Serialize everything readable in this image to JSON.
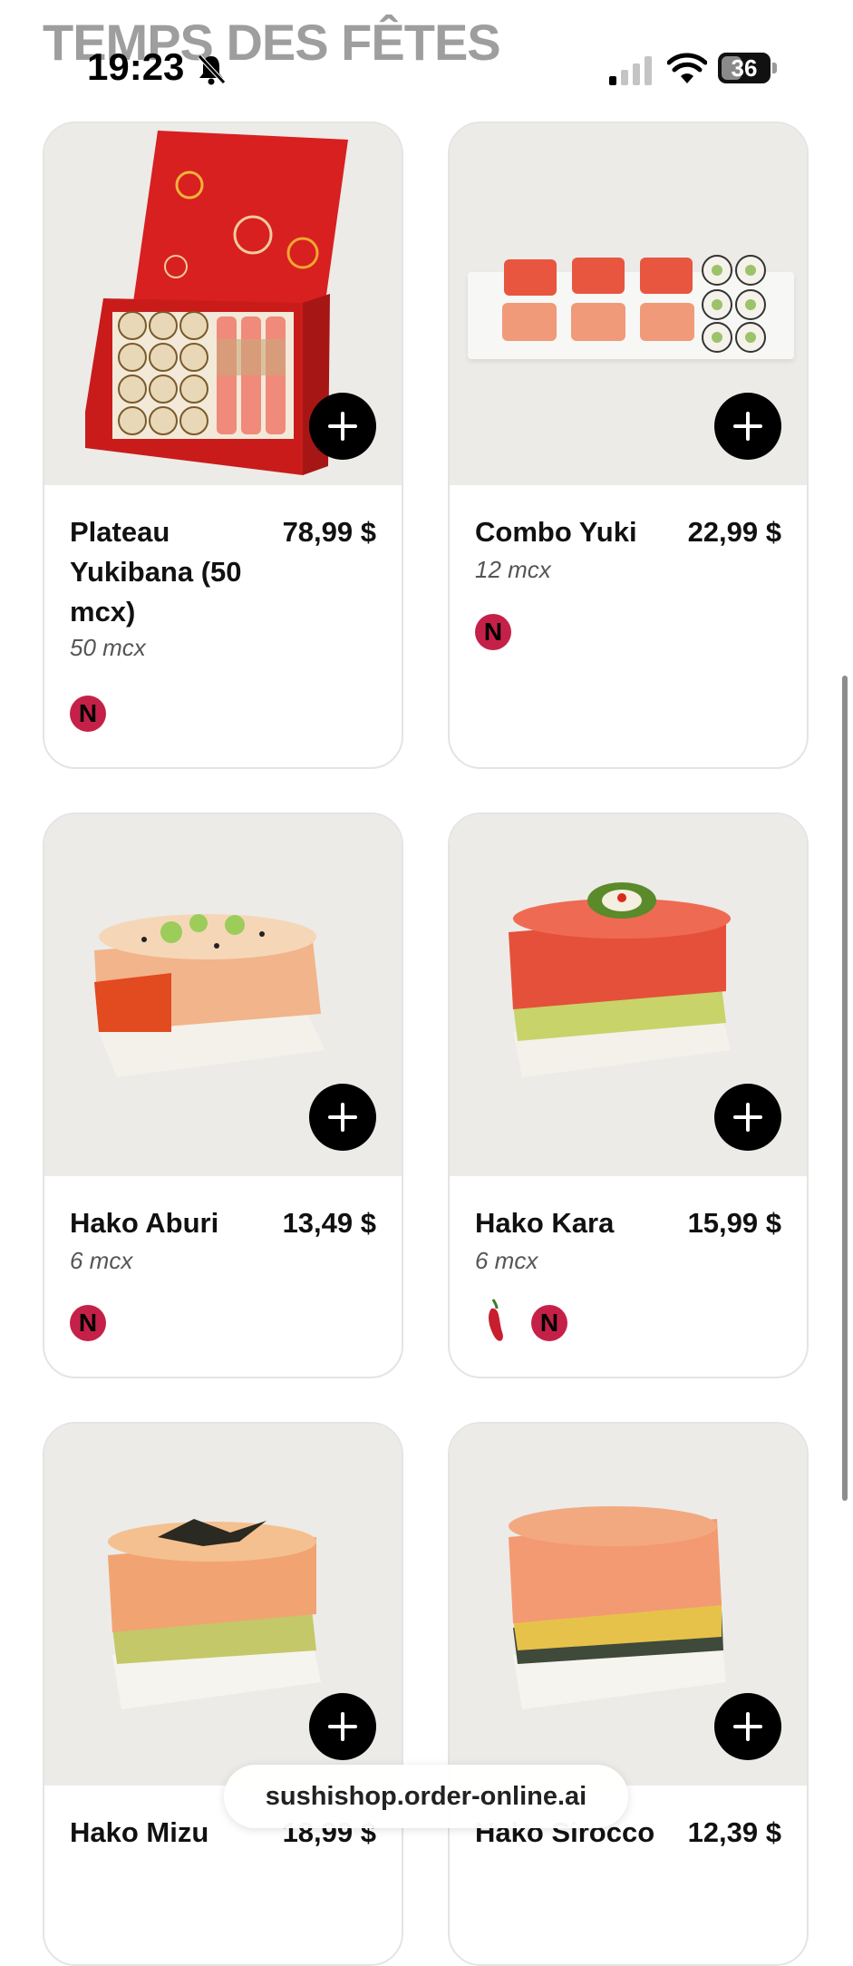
{
  "status_bar": {
    "time": "19:23",
    "battery": "36"
  },
  "section": {
    "title": "TEMPS DES FÊTES"
  },
  "products": [
    {
      "name": "Plateau Yukibana (50 mcx)",
      "price": "78,99 $",
      "qty": "50 mcx",
      "badges": [
        "N"
      ]
    },
    {
      "name": "Combo Yuki",
      "price": "22,99 $",
      "qty": "12 mcx",
      "badges": [
        "N"
      ]
    },
    {
      "name": "Hako Aburi",
      "price": "13,49 $",
      "qty": "6 mcx",
      "badges": [
        "N"
      ]
    },
    {
      "name": "Hako Kara",
      "price": "15,99 $",
      "qty": "6 mcx",
      "badges": [
        "chili",
        "N"
      ]
    },
    {
      "name": "Hako Mizu",
      "price": "18,99 $"
    },
    {
      "name": "Hako Sirocco",
      "price": "12,39 $"
    }
  ],
  "icons": {
    "add": "plus-icon",
    "badge": "n-badge-icon",
    "spicy": "chili-icon"
  },
  "colors": {
    "badge": "#c52148",
    "add_button": "#000000",
    "card_border": "#e4e4e4",
    "image_bg": "#ecebe8"
  },
  "url_bar": {
    "domain": "sushishop.order-online.ai"
  }
}
